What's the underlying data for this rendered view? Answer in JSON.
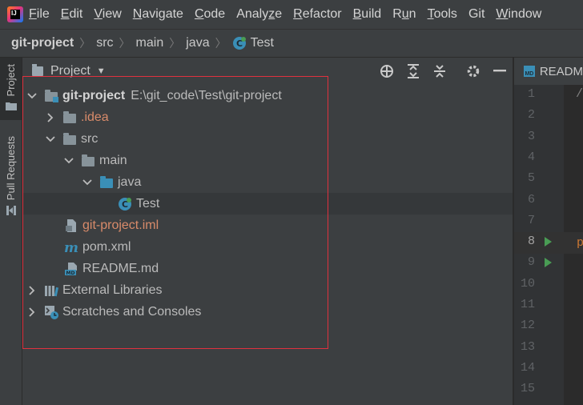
{
  "menu": {
    "items": [
      {
        "pre": "",
        "mn": "F",
        "post": "ile"
      },
      {
        "pre": "",
        "mn": "E",
        "post": "dit"
      },
      {
        "pre": "",
        "mn": "V",
        "post": "iew"
      },
      {
        "pre": "",
        "mn": "N",
        "post": "avigate"
      },
      {
        "pre": "",
        "mn": "C",
        "post": "ode"
      },
      {
        "pre": "Analy",
        "mn": "z",
        "post": "e"
      },
      {
        "pre": "",
        "mn": "R",
        "post": "efactor"
      },
      {
        "pre": "",
        "mn": "B",
        "post": "uild"
      },
      {
        "pre": "R",
        "mn": "u",
        "post": "n"
      },
      {
        "pre": "",
        "mn": "T",
        "post": "ools"
      },
      {
        "pre": "Git",
        "mn": "",
        "post": ""
      },
      {
        "pre": "",
        "mn": "W",
        "post": "indow"
      }
    ]
  },
  "breadcrumb": [
    "git-project",
    "src",
    "main",
    "java",
    "Test"
  ],
  "left_stripe": {
    "project_tab": "Project",
    "pull_requests_tab": "Pull Requests"
  },
  "project_panel": {
    "title": "Project",
    "tree": [
      {
        "label": "git-project",
        "path": "E:\\git_code\\Test\\git-project",
        "depth": 0,
        "expanded": true,
        "icon": "module-folder-icon"
      },
      {
        "label": ".idea",
        "depth": 1,
        "expanded": false,
        "icon": "folder-icon"
      },
      {
        "label": "src",
        "depth": 1,
        "expanded": true,
        "icon": "folder-icon"
      },
      {
        "label": "main",
        "depth": 2,
        "expanded": true,
        "icon": "folder-icon"
      },
      {
        "label": "java",
        "depth": 3,
        "expanded": true,
        "icon": "source-folder-icon"
      },
      {
        "label": "Test",
        "depth": 4,
        "icon": "java-class-icon",
        "selected": true
      },
      {
        "label": "git-project.iml",
        "depth": 1,
        "icon": "iml-file-icon"
      },
      {
        "label": "pom.xml",
        "depth": 1,
        "icon": "maven-file-icon"
      },
      {
        "label": "README.md",
        "depth": 1,
        "icon": "markdown-file-icon"
      },
      {
        "label": "External Libraries",
        "depth": 0,
        "expanded": false,
        "icon": "libraries-icon"
      },
      {
        "label": "Scratches and Consoles",
        "depth": 0,
        "expanded": false,
        "icon": "scratches-icon"
      }
    ]
  },
  "editor": {
    "tab_label": "READM",
    "tab_badge": "MD",
    "line_numbers": [
      "1",
      "2",
      "3",
      "4",
      "5",
      "6",
      "7",
      "8",
      "9",
      "10",
      "11",
      "12",
      "13",
      "14",
      "15"
    ],
    "current_line": "8",
    "run_lines": [
      "8",
      "9"
    ],
    "code_fragments": {
      "line1": "/",
      "line8": "p"
    }
  },
  "colors": {
    "highlight_box": "#e0313e",
    "accent_blue": "#3a8fb7",
    "run_green": "#499c54"
  }
}
